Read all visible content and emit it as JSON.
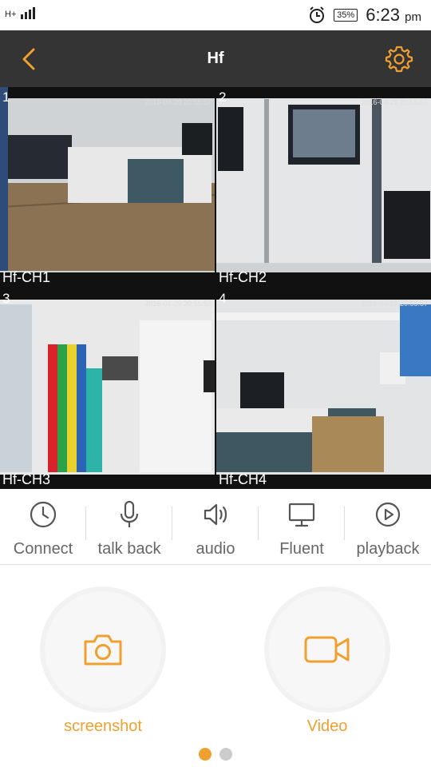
{
  "status_bar": {
    "carrier": "H+",
    "battery": "35%",
    "time": "6:23",
    "ampm": "pm"
  },
  "app_bar": {
    "title": "Hf"
  },
  "cameras": [
    {
      "number": "1",
      "timestamp": "2016-04-29 20:55:57",
      "name": "Hf-CH1"
    },
    {
      "number": "2",
      "timestamp": "2016-04-29 20:55:57",
      "name": "Hf-CH2"
    },
    {
      "number": "3",
      "timestamp": "2016-04-29 20:55:57",
      "name": "Hf-CH3"
    },
    {
      "number": "4",
      "timestamp": "2016-04-29 20:55:57",
      "name": "Hf-CH4"
    }
  ],
  "controls": [
    {
      "label": "Connect",
      "icon": "clock-icon"
    },
    {
      "label": "talk back",
      "icon": "microphone-icon"
    },
    {
      "label": "audio",
      "icon": "speaker-icon"
    },
    {
      "label": "Fluent",
      "icon": "monitor-icon"
    },
    {
      "label": "playback",
      "icon": "play-circle-icon"
    }
  ],
  "actions": {
    "screenshot_label": "screenshot",
    "video_label": "Video"
  },
  "colors": {
    "accent": "#f0a030",
    "appbar": "#343434",
    "selected_border": "#2a8fd4"
  }
}
